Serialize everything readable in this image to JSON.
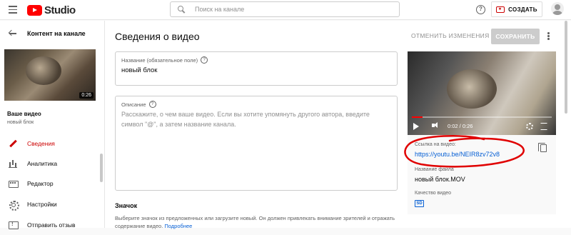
{
  "header": {
    "logo_text": "Studio",
    "search_placeholder": "Поиск на канале",
    "help_symbol": "?",
    "create_label": "СОЗДАТЬ"
  },
  "sidebar": {
    "back_label": "Контент на канале",
    "thumbnail_duration": "0:26",
    "your_video_label": "Ваше видео",
    "video_name": "новый блок",
    "items": [
      {
        "label": "Сведения",
        "icon": "pencil-icon",
        "active": true
      },
      {
        "label": "Аналитика",
        "icon": "chart-icon",
        "active": false
      },
      {
        "label": "Редактор",
        "icon": "editor-icon",
        "active": false
      },
      {
        "label": "Настройки",
        "icon": "gear-icon",
        "active": false
      },
      {
        "label": "Отправить отзыв",
        "icon": "feedback-icon",
        "active": false
      }
    ]
  },
  "main": {
    "title": "Сведения о видео",
    "undo_label": "ОТМЕНИТЬ ИЗМЕНЕНИЯ",
    "save_label": "СОХРАНИТЬ",
    "title_field": {
      "label": "Название (обязательное поле)",
      "help_symbol": "?",
      "value": "новый блок"
    },
    "description_field": {
      "label": "Описание",
      "help_symbol": "?",
      "placeholder": "Расскажите, о чем ваше видео. Если вы хотите упомянуть другого автора, введите символ \"@\", а затем название канала."
    },
    "thumbnail_section": {
      "heading": "Значок",
      "text": "Выберите значок из предложенных или загрузите новый. Он должен привлекать внимание зрителей и отражать содержание видео.",
      "link": "Подробнее"
    }
  },
  "preview": {
    "time_label": "0:02 / 0:26",
    "progress": 0.077,
    "link_label": "Ссылка на видео:",
    "link_value": "https://youtu.be/NEIR8zv72v8",
    "file_label": "Название файла",
    "file_value": "новый блок.MOV",
    "quality_label": "Качество видео",
    "quality_badge": "SD"
  },
  "colors": {
    "accent": "#cc0000",
    "link": "#065fd4",
    "annotation": "#e00000"
  }
}
